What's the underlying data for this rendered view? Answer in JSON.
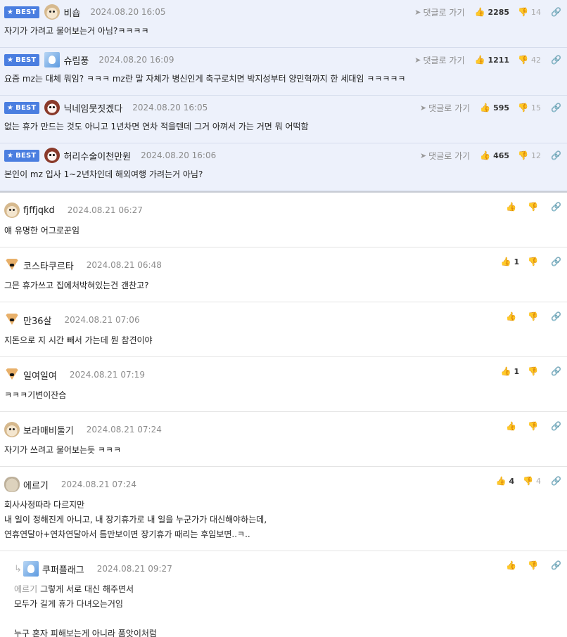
{
  "labels": {
    "best": "BEST",
    "reply": "댓글로 가기"
  },
  "best_comments": [
    {
      "avatar": "dog-avatar",
      "nick": "비숍",
      "date": "2024.08.20 16:05",
      "up": "2285",
      "down": "14",
      "text": "자기가 가려고 물어보는거 아님?ㅋㅋㅋㅋ"
    },
    {
      "avatar": "blue-avatar",
      "nick": "슈림풍",
      "date": "2024.08.20 16:09",
      "up": "1211",
      "down": "42",
      "text": "요즘 mz는 대체 뭐임? ㅋㅋㅋ mz란 말 자체가 병신인게 축구로치면 박지성부터 양민혁까지 한 세대임 ㅋㅋㅋㅋㅋ"
    },
    {
      "avatar": "red-avatar",
      "nick": "닉네임뭇짓겠다",
      "date": "2024.08.20 16:05",
      "up": "595",
      "down": "15",
      "text": "없는 휴가 만드는 것도 아니고 1년차면 연차 적을텐데 그거 아껴서 가는 거면 뭐 어떡함"
    },
    {
      "avatar": "red-avatar",
      "nick": "허리수술이천만원",
      "date": "2024.08.20 16:06",
      "up": "465",
      "down": "12",
      "text": "본인이 mz 입사 1~2년차인데 해외여행 가려는거 아님?"
    }
  ],
  "comments": [
    {
      "avatar": "dog-avatar",
      "nick": "fjffjqkd",
      "date": "2024.08.21 06:27",
      "up": "",
      "down": "",
      "lines": [
        "얘 유명한 어그로꾼임"
      ]
    },
    {
      "avatar": "fox-avatar",
      "nick": "코스타쿠르타",
      "date": "2024.08.21 06:48",
      "up": "1",
      "down": "",
      "lines": [
        "그믄 휴가쓰고 집에처박혀있는건 갠찬고?"
      ]
    },
    {
      "avatar": "fox-avatar",
      "nick": "만36살",
      "date": "2024.08.21 07:06",
      "up": "",
      "down": "",
      "lines": [
        "지돈으로 지 시간 빼서 가는데 뭔 참견이야"
      ]
    },
    {
      "avatar": "fox-avatar",
      "nick": "일여일여",
      "date": "2024.08.21 07:19",
      "up": "1",
      "down": "",
      "lines": [
        "ㅋㅋㅋ기변이잔슴"
      ]
    },
    {
      "avatar": "dog-avatar",
      "nick": "보라매비둘기",
      "date": "2024.08.21 07:24",
      "up": "",
      "down": "",
      "lines": [
        "자기가 쓰려고 물어보는듯 ㅋㅋㅋ"
      ]
    },
    {
      "avatar": "beige-avatar",
      "nick": "에르기",
      "date": "2024.08.21 07:24",
      "up": "4",
      "down": "4",
      "lines": [
        "회사사정따라 다르지만",
        "내 일이 정해진게 아니고, 내 장기휴가로 내 일을 누군가가 대신해야하는데,",
        "연휴연달아+연차연달아서 틈만보이면 장기휴가 때리는 후임보면..ㅋ.."
      ]
    }
  ],
  "reply": {
    "avatar": "blue-avatar",
    "nick": "쿠퍼플래그",
    "date": "2024.08.21 09:27",
    "mention": "에르기",
    "lines": [
      "그렇게 서로 대신 해주면서",
      "모두가 길게 휴가 다녀오는거임",
      "",
      "누구 혼자 피해보는게 아니라 품앗이처럼"
    ]
  },
  "colors": {
    "best_bg": "#edf1fb",
    "badge": "#4a7ee0"
  }
}
